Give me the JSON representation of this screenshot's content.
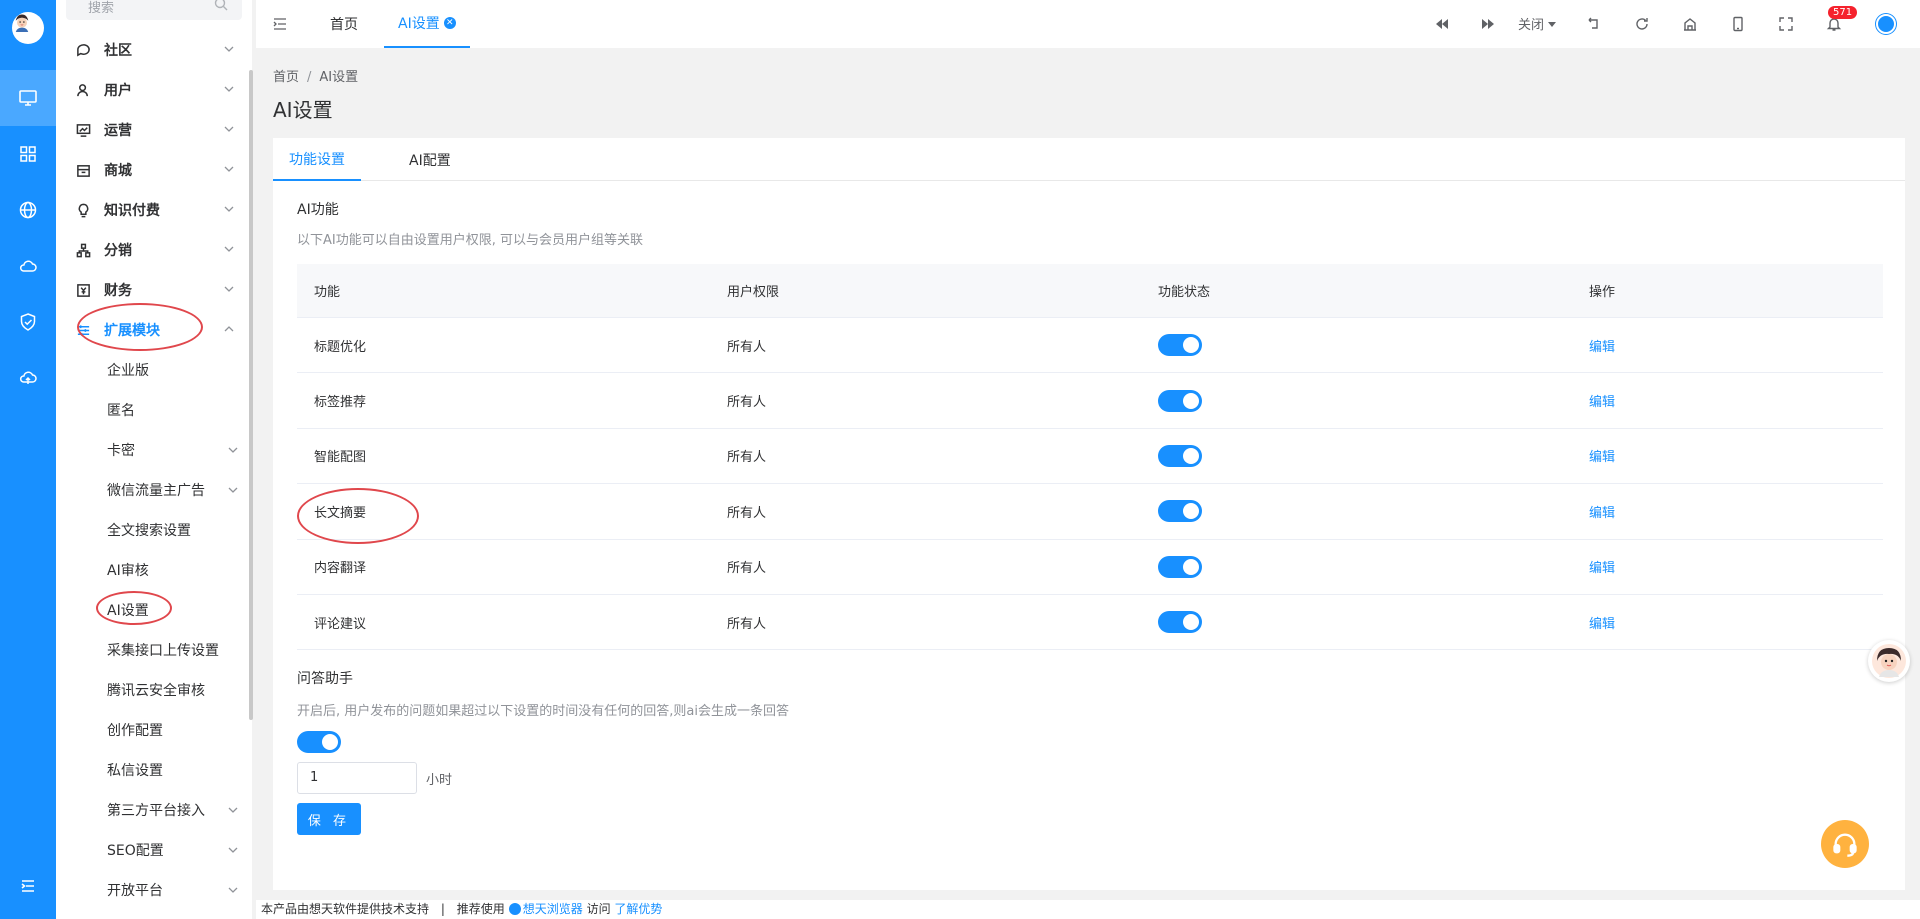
{
  "sidebar": {
    "search_placeholder": "搜索",
    "menu": [
      {
        "label": "社区"
      },
      {
        "label": "用户"
      },
      {
        "label": "运营"
      },
      {
        "label": "商城"
      },
      {
        "label": "知识付费"
      },
      {
        "label": "分销"
      },
      {
        "label": "财务"
      },
      {
        "label": "扩展模块"
      }
    ],
    "submenu": [
      {
        "label": "企业版"
      },
      {
        "label": "匿名"
      },
      {
        "label": "卡密"
      },
      {
        "label": "微信流量主广告"
      },
      {
        "label": "全文搜索设置"
      },
      {
        "label": "AI审核"
      },
      {
        "label": "AI设置"
      },
      {
        "label": "采集接口上传设置"
      },
      {
        "label": "腾讯云安全审核"
      },
      {
        "label": "创作配置"
      },
      {
        "label": "私信设置"
      },
      {
        "label": "第三方平台接入"
      },
      {
        "label": "SEO配置"
      },
      {
        "label": "开放平台"
      }
    ]
  },
  "topbar": {
    "tab_home": "首页",
    "tab_ai": "AI设置",
    "close_label": "关闭",
    "notification_count": "571"
  },
  "breadcrumb": {
    "home": "首页",
    "sep": "/",
    "current": "AI设置"
  },
  "page_title": "AI设置",
  "card": {
    "tabs": [
      "功能设置",
      "AI配置"
    ],
    "ai_section": {
      "title": "AI功能",
      "desc": "以下AI功能可以自由设置用户权限, 可以与会员用户组等关联"
    },
    "table": {
      "headers": [
        "功能",
        "用户权限",
        "功能状态",
        "操作"
      ],
      "rows": [
        {
          "name": "标题优化",
          "perm": "所有人",
          "enabled": true,
          "action": "编辑"
        },
        {
          "name": "标签推荐",
          "perm": "所有人",
          "enabled": true,
          "action": "编辑"
        },
        {
          "name": "智能配图",
          "perm": "所有人",
          "enabled": true,
          "action": "编辑"
        },
        {
          "name": "长文摘要",
          "perm": "所有人",
          "enabled": true,
          "action": "编辑"
        },
        {
          "name": "内容翻译",
          "perm": "所有人",
          "enabled": true,
          "action": "编辑"
        },
        {
          "name": "评论建议",
          "perm": "所有人",
          "enabled": true,
          "action": "编辑"
        }
      ]
    },
    "qa_section": {
      "title": "问答助手",
      "desc": "开启后, 用户发布的问题如果超过以下设置的时间没有任何的回答,则ai会生成一条回答",
      "enabled": true,
      "hours_value": "1",
      "unit": "小时",
      "save_label": "保 存"
    }
  },
  "footer": {
    "text1": "本产品由想天软件提供技术支持",
    "sep": "|",
    "text2": "推荐使用",
    "browser": "想天浏览器",
    "text3": "访问",
    "more": "了解优势"
  },
  "colors": {
    "accent": "#1890ff",
    "annotation": "#e0474c",
    "support": "#ffb23f"
  }
}
